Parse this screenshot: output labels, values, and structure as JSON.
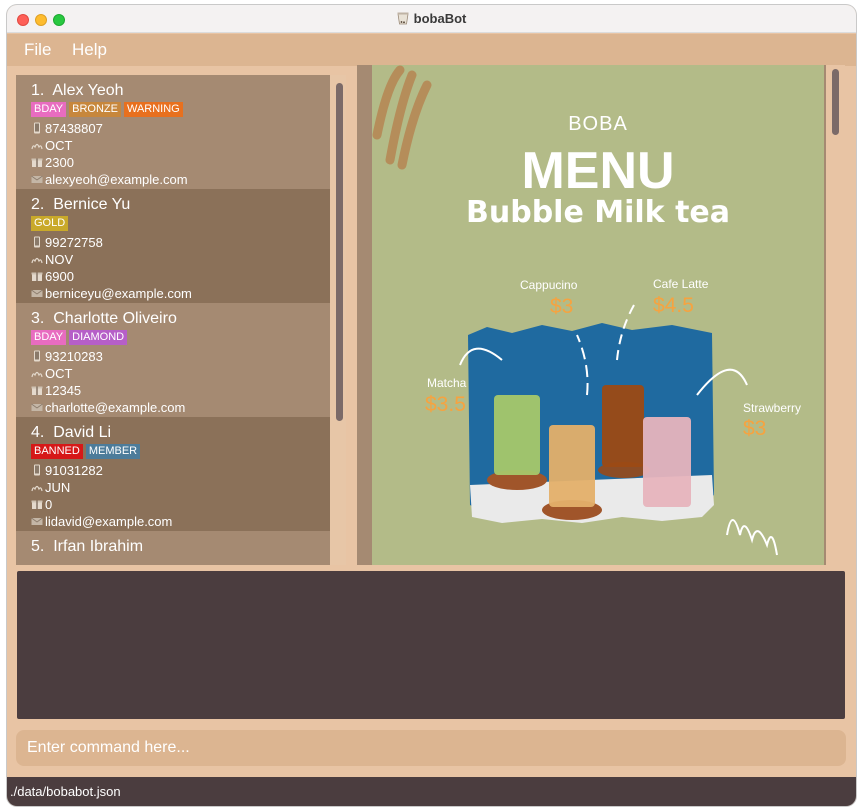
{
  "window": {
    "title": "bobaBot"
  },
  "menubar": {
    "file": "File",
    "help": "Help"
  },
  "customers": [
    {
      "index": "1.",
      "name": "Alex Yeoh",
      "tags": [
        {
          "label": "BDAY",
          "color": "#e86cc0"
        },
        {
          "label": "BRONZE",
          "color": "#c7873c"
        },
        {
          "label": "WARNING",
          "color": "#e8701e"
        }
      ],
      "phone": "87438807",
      "month": "OCT",
      "points": "2300",
      "email": "alexyeoh@example.com"
    },
    {
      "index": "2.",
      "name": "Bernice Yu",
      "tags": [
        {
          "label": "GOLD",
          "color": "#c9a92a"
        }
      ],
      "phone": "99272758",
      "month": "NOV",
      "points": "6900",
      "email": "berniceyu@example.com"
    },
    {
      "index": "3.",
      "name": "Charlotte Oliveiro",
      "tags": [
        {
          "label": "BDAY",
          "color": "#e86cc0"
        },
        {
          "label": "DIAMOND",
          "color": "#b65fc8"
        }
      ],
      "phone": "93210283",
      "month": "OCT",
      "points": "12345",
      "email": "charlotte@example.com"
    },
    {
      "index": "4.",
      "name": "David Li",
      "tags": [
        {
          "label": "BANNED",
          "color": "#d61818"
        },
        {
          "label": "MEMBER",
          "color": "#4d7c9a"
        }
      ],
      "phone": "91031282",
      "month": "JUN",
      "points": "0",
      "email": "lidavid@example.com"
    },
    {
      "index": "5.",
      "name": "Irfan Ibrahim"
    }
  ],
  "boba_menu": {
    "header": "BOBA",
    "title": "MENU",
    "subtitle": "Bubble Milk tea",
    "drinks": [
      {
        "name": "Cappucino",
        "price": "$3"
      },
      {
        "name": "Cafe Latte",
        "price": "$4.5"
      },
      {
        "name": "Matcha",
        "price": "$3.5"
      },
      {
        "name": "Strawberry",
        "price": "$3"
      }
    ]
  },
  "command": {
    "placeholder": "Enter command here..."
  },
  "status": {
    "path": "./data/bobabot.json"
  }
}
